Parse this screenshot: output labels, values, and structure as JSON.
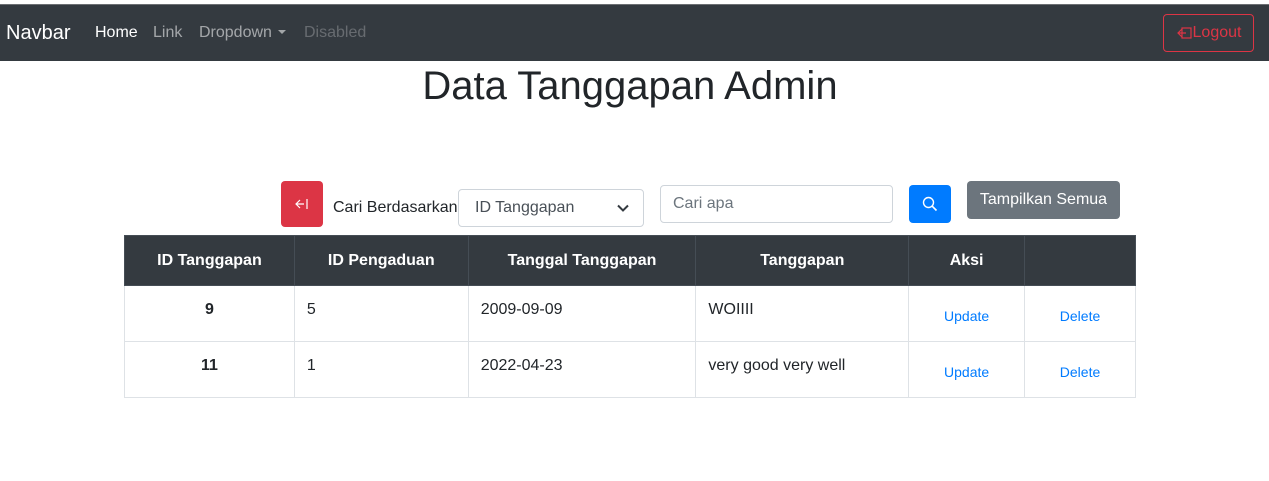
{
  "navbar": {
    "brand": "Navbar",
    "links": [
      {
        "label": "Home",
        "state": "active"
      },
      {
        "label": "Link",
        "state": "normal"
      },
      {
        "label": "Dropdown",
        "state": "normal"
      },
      {
        "label": "Disabled",
        "state": "disabled"
      }
    ],
    "logout_label": "Logout",
    "logout_icon": "logout-icon"
  },
  "page": {
    "title": "Data Tanggapan Admin"
  },
  "search": {
    "back_icon": "back-arrow-icon",
    "label": "Cari Berdasarkan",
    "select_value": "ID Tanggapan",
    "input_placeholder": "Cari apa",
    "input_value": "",
    "search_icon": "search-icon",
    "show_all_label": "Tampilkan Semua"
  },
  "table": {
    "headers": [
      "ID Tanggapan",
      "ID Pengaduan",
      "Tanggal Tanggapan",
      "Tanggapan",
      "Aksi",
      ""
    ],
    "rows": [
      {
        "id_tanggapan": "9",
        "id_pengaduan": "5",
        "tanggal": "2009-09-09",
        "tanggapan": "WOIIII",
        "update": "Update",
        "delete": "Delete"
      },
      {
        "id_tanggapan": "11",
        "id_pengaduan": "1",
        "tanggal": "2022-04-23",
        "tanggapan": "very good very well",
        "update": "Update",
        "delete": "Delete"
      }
    ]
  },
  "colors": {
    "navbar_bg": "#343a40",
    "danger": "#dc3545",
    "primary": "#007bff",
    "secondary": "#6c757d"
  }
}
